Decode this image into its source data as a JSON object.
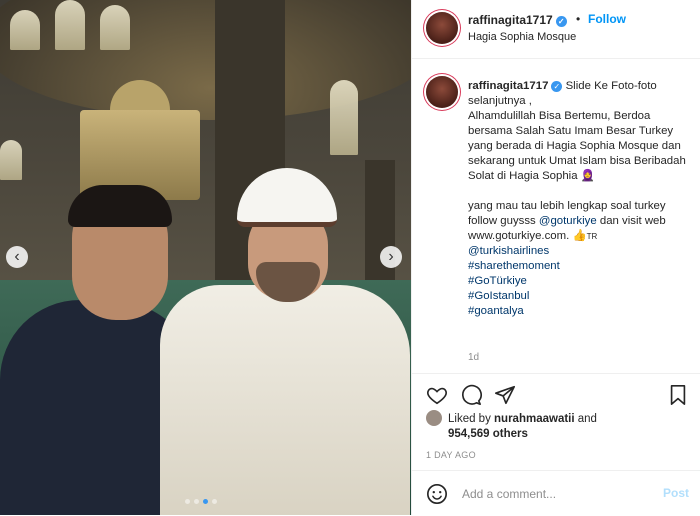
{
  "post": {
    "username": "raffinagita1717",
    "verified": true,
    "follow_label": "Follow",
    "separator": "•",
    "location": "Hagia Sophia Mosque"
  },
  "caption": {
    "username": "raffinagita1717",
    "line1": " Slide Ke Foto-foto selanjutnya ,",
    "line2": "Alhamdulillah Bisa Bertemu, Berdoa bersama Salah Satu Imam Besar Turkey yang berada di Hagia Sophia Mosque dan sekarang untuk Umat Islam bisa Beribadah Solat di Hagia Sophia",
    "line2_emoji": "🧕",
    "para2_prefix": "yang mau tau lebih lengkap soal turkey follow guysss ",
    "mention_goturkiye": "@goturkiye",
    "para2_mid": " dan visit web www.goturkiye.com. ",
    "para2_emoji": "👍",
    "para2_tr": "TR",
    "mention_turkish": "@turkishairlines",
    "hashtags": [
      "#sharethemoment",
      "#GoTürkiye",
      "#GoIstanbul",
      "#goantalya"
    ],
    "time_ago": "1d"
  },
  "engagement": {
    "liked_by_prefix": "Liked by ",
    "liked_by_user": "nurahmaawatii",
    "liked_by_suffix": " and",
    "others": "954,569 others",
    "posted_ago": "1 DAY AGO"
  },
  "comment": {
    "placeholder": "Add a comment...",
    "post_label": "Post"
  },
  "carousel": {
    "prev_label": "‹",
    "next_label": "›",
    "dot_count": 4,
    "active_index": 2
  },
  "colors": {
    "accent": "#0095f6",
    "verified": "#3897f0",
    "link": "#00376b",
    "muted": "#8e8e8e"
  }
}
